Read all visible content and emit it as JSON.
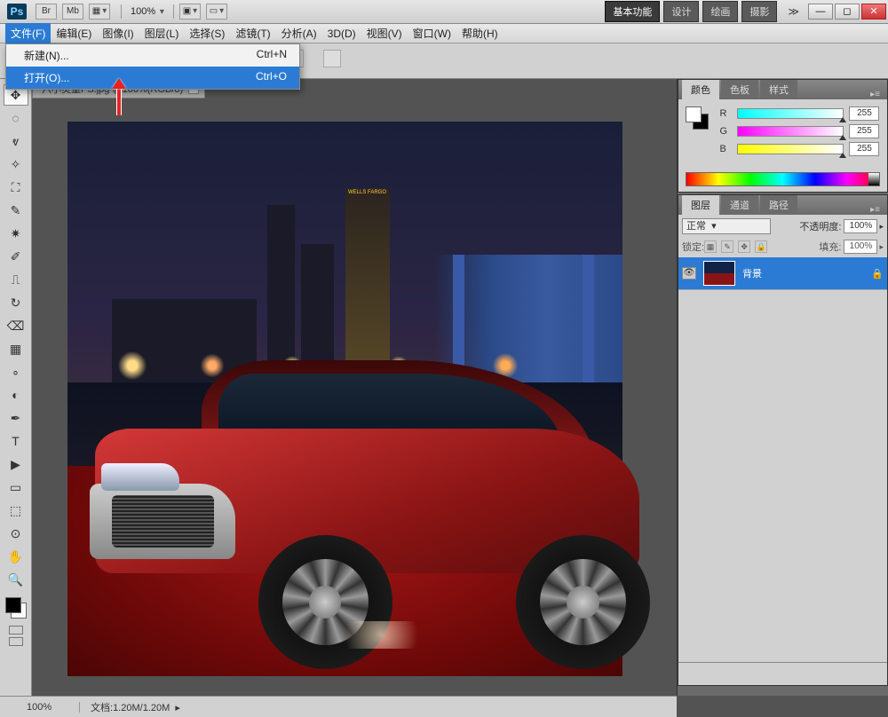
{
  "titlebar": {
    "app_logo": "Ps",
    "br_btn": "Br",
    "mb_btn": "Mb",
    "zoom": "100%",
    "workspace": {
      "active": "基本功能",
      "items": [
        "基本功能",
        "设计",
        "绘画",
        "摄影"
      ]
    }
  },
  "menubar": [
    "文件(F)",
    "编辑(E)",
    "图像(I)",
    "图层(L)",
    "选择(S)",
    "滤镜(T)",
    "分析(A)",
    "3D(D)",
    "视图(V)",
    "窗口(W)",
    "帮助(H)"
  ],
  "dropdown": {
    "items": [
      {
        "label": "新建(N)...",
        "shortcut": "Ctrl+N"
      },
      {
        "label": "打开(O)...",
        "shortcut": "Ctrl+O",
        "highlight": true
      }
    ]
  },
  "doc_tab": "六小灵童PS.jpg @100%(RGB/8)",
  "color_panel": {
    "tabs": [
      "颜色",
      "色板",
      "样式"
    ],
    "r": {
      "label": "R",
      "value": "255"
    },
    "g": {
      "label": "G",
      "value": "255"
    },
    "b": {
      "label": "B",
      "value": "255"
    }
  },
  "layers_panel": {
    "tabs": [
      "图层",
      "通道",
      "路径"
    ],
    "blend_mode": "正常",
    "opacity_label": "不透明度:",
    "opacity": "100%",
    "lock_label": "锁定:",
    "fill_label": "填充:",
    "fill": "100%",
    "layer_name": "背景"
  },
  "statusbar": {
    "zoom": "100%",
    "doc_label": "文档:",
    "doc_size": "1.20M/1.20M"
  }
}
